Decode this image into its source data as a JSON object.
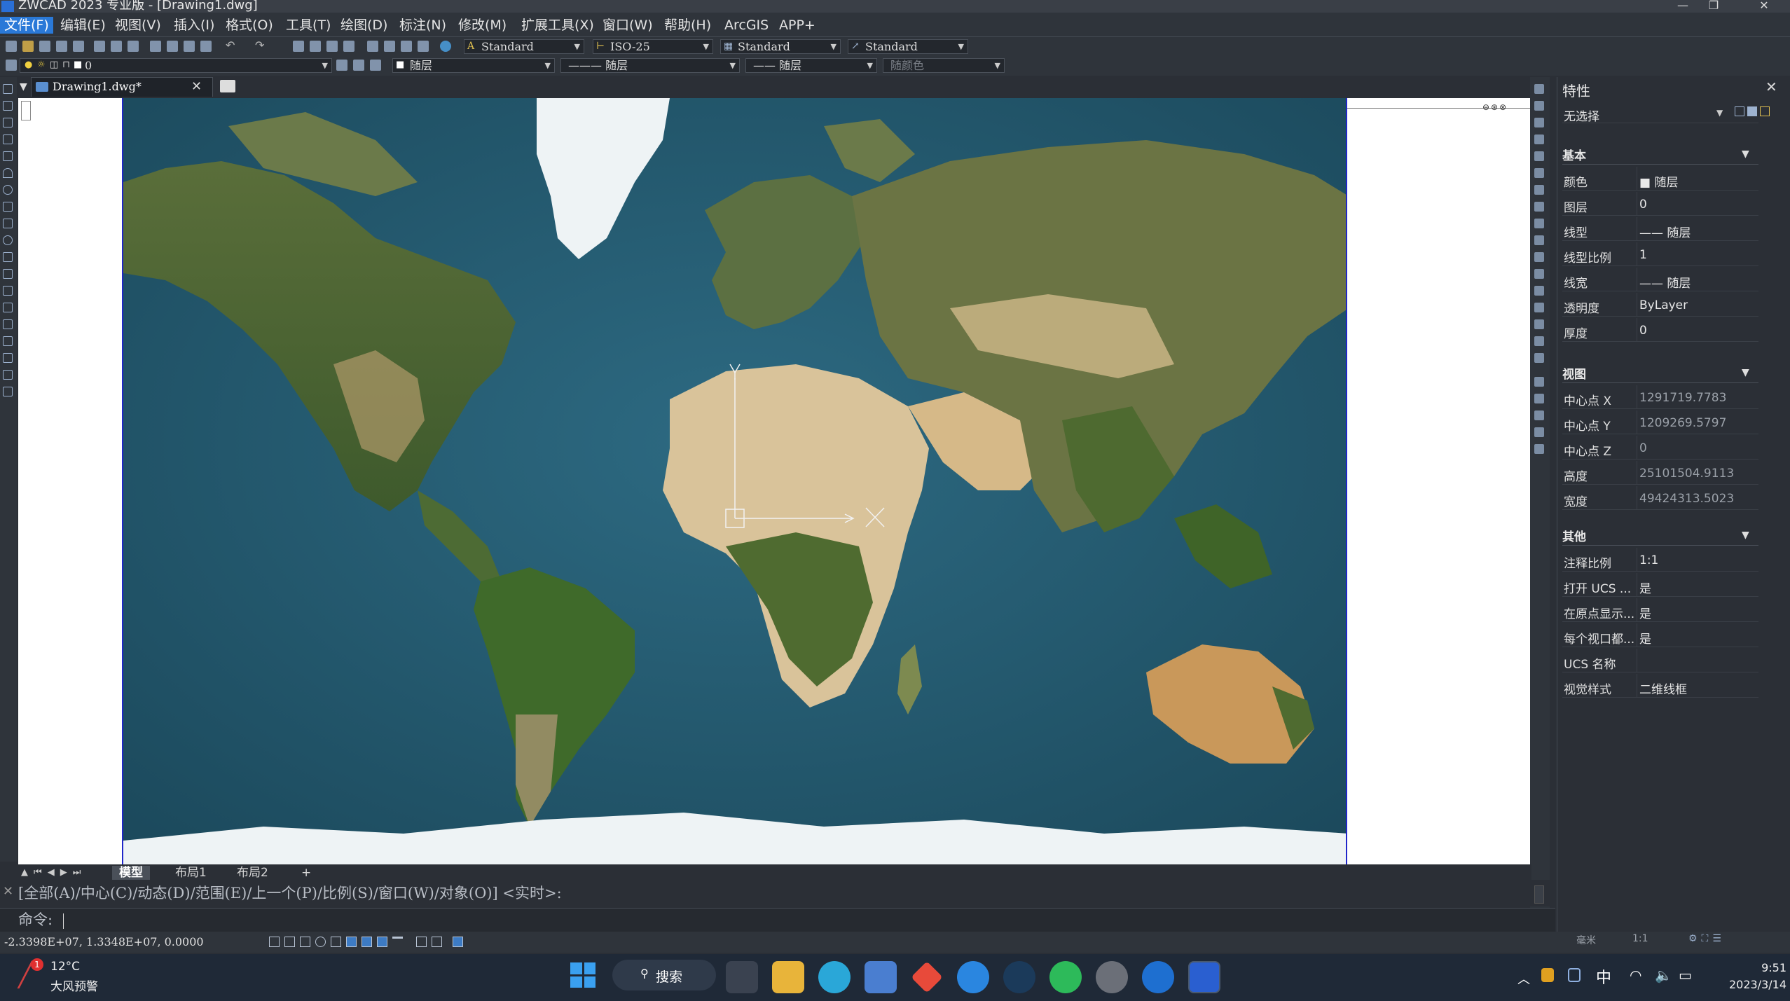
{
  "window": {
    "title": "ZWCAD 2023 专业版 - [Drawing1.dwg]",
    "controls": [
      "—",
      "❐",
      "✕"
    ]
  },
  "menu": [
    {
      "label": "文件(F)",
      "active": true
    },
    {
      "label": "编辑(E)"
    },
    {
      "label": "视图(V)"
    },
    {
      "label": "插入(I)"
    },
    {
      "label": "格式(O)"
    },
    {
      "label": "工具(T)"
    },
    {
      "label": "绘图(D)"
    },
    {
      "label": "标注(N)"
    },
    {
      "label": "修改(M)"
    },
    {
      "label": "扩展工具(X)"
    },
    {
      "label": "窗口(W)"
    },
    {
      "label": "帮助(H)"
    },
    {
      "label": "ArcGIS"
    },
    {
      "label": "APP+"
    }
  ],
  "toolbar": {
    "text_style": "Standard",
    "dim_style": "ISO-25",
    "table_style": "Standard",
    "mleader_style": "Standard",
    "layer": "0",
    "color": "随层",
    "linetype": "——— 随层",
    "lineweight": "—— 随层",
    "plotstyle": "随颜色"
  },
  "document": {
    "tab_label": "Drawing1.dwg*",
    "close_glyph": "✕"
  },
  "properties": {
    "title": "特性",
    "selection": "无选择",
    "sections": [
      {
        "name": "基本",
        "rows": [
          {
            "label": "颜色",
            "value": "■ 随层"
          },
          {
            "label": "图层",
            "value": "0"
          },
          {
            "label": "线型",
            "value": "—— 随层"
          },
          {
            "label": "线型比例",
            "value": "1"
          },
          {
            "label": "线宽",
            "value": "—— 随层"
          },
          {
            "label": "透明度",
            "value": "ByLayer"
          },
          {
            "label": "厚度",
            "value": "0"
          }
        ]
      },
      {
        "name": "视图",
        "rows": [
          {
            "label": "中心点 X",
            "value": "1291719.7783",
            "dim": true
          },
          {
            "label": "中心点 Y",
            "value": "1209269.5797",
            "dim": true
          },
          {
            "label": "中心点 Z",
            "value": "0",
            "dim": true
          },
          {
            "label": "高度",
            "value": "25101504.9113",
            "dim": true
          },
          {
            "label": "宽度",
            "value": "49424313.5023",
            "dim": true
          }
        ]
      },
      {
        "name": "其他",
        "rows": [
          {
            "label": "注释比例",
            "value": "1:1"
          },
          {
            "label": "打开 UCS ...",
            "value": "是"
          },
          {
            "label": "在原点显示...",
            "value": "是"
          },
          {
            "label": "每个视口都...",
            "value": "是"
          },
          {
            "label": "UCS 名称",
            "value": ""
          },
          {
            "label": "视觉样式",
            "value": "二维线框"
          }
        ]
      }
    ]
  },
  "layout_tabs": [
    "模型",
    "布局1",
    "布局2",
    "+"
  ],
  "command": {
    "history": "[全部(A)/中心(C)/动态(D)/范围(E)/上一个(P)/比例(S)/窗口(W)/对象(O)] <实时>:",
    "prompt": "命令:"
  },
  "status": {
    "coords": "-2.3398E+07, 1.3348E+07, 0.0000",
    "units": "毫米",
    "scale": "1:1"
  },
  "taskbar": {
    "weather_temp": "12°C",
    "weather_alert": "大风预警",
    "search_label": "搜索",
    "ime": "中",
    "time": "9:51",
    "date": "2023/3/14"
  },
  "colors": {
    "accent": "#2a79d8",
    "ocean": "#24596d",
    "viewport_border": "#2026c9"
  }
}
